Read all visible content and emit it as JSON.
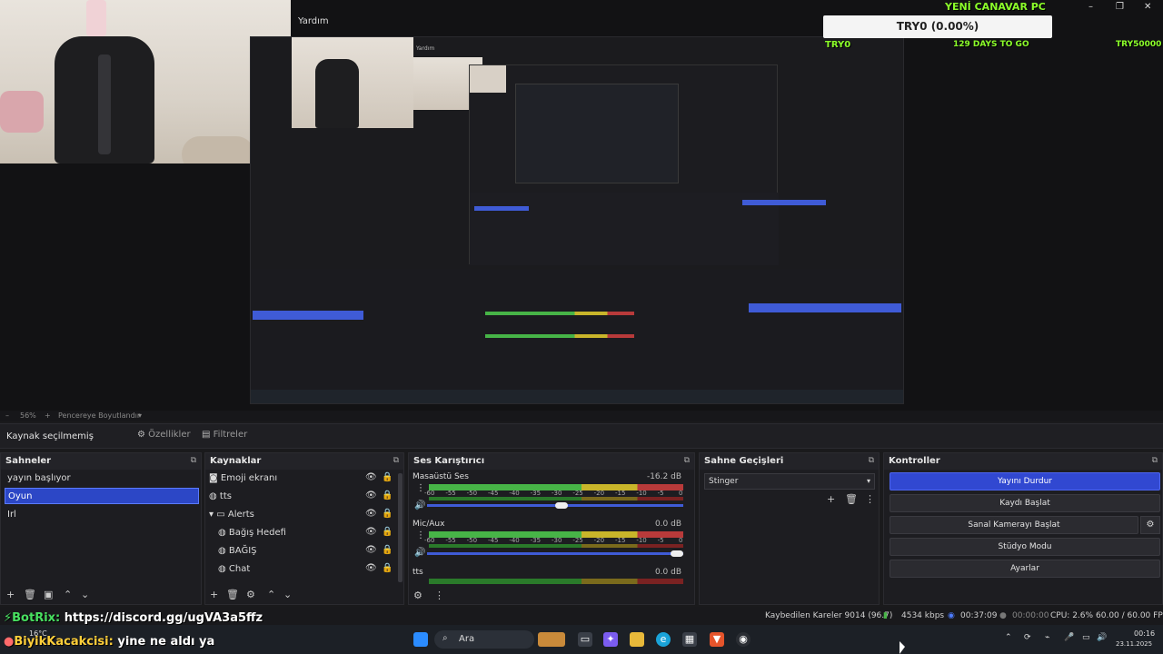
{
  "preview": {
    "window_title": "Yardım",
    "overlay": {
      "header": "YENİ CANAVAR PC",
      "progress_text": "TRY0 (0.00%)",
      "left_label": "TRY0",
      "countdown": "129 DAYS TO GO",
      "goal": "TRY50000",
      "progress_fraction": 0.0
    },
    "nested_title": "Yardım",
    "window_controls": {
      "minimize": "–",
      "maximize": "❐",
      "close": "✕"
    }
  },
  "zoombar": {
    "minus": "–",
    "zoom": "56%",
    "plus": "+",
    "fit": "Pencereye Boyutlandır",
    "dropdown": "▾"
  },
  "source_bar": {
    "label": "Kaynak seçilmemiş",
    "properties": "Özellikler",
    "filters": "Filtreler"
  },
  "scenes": {
    "title": "Sahneler",
    "items": [
      "yayın başlıyor",
      "Oyun",
      "Irl"
    ],
    "selected_index": 1
  },
  "sources": {
    "title": "Kaynaklar",
    "items": [
      {
        "label": "Emoji ekranı",
        "icon": "window-capture-icon"
      },
      {
        "label": "tts",
        "icon": "globe-icon"
      },
      {
        "label": "Alerts",
        "icon": "folder-icon"
      },
      {
        "label": "Bağış Hedefi",
        "icon": "globe-icon"
      },
      {
        "label": "BAĞIŞ",
        "icon": "globe-icon"
      },
      {
        "label": "Chat",
        "icon": "globe-icon"
      }
    ]
  },
  "mixer": {
    "title": "Ses Karıştırıcı",
    "ticks": [
      "-60",
      "-55",
      "-50",
      "-45",
      "-40",
      "-35",
      "-30",
      "-25",
      "-20",
      "-15",
      "-10",
      "-5",
      "0"
    ],
    "channels": [
      {
        "name": "Masaüstü Ses",
        "db": "-16.2 dB",
        "volume": 0.55
      },
      {
        "name": "Mic/Aux",
        "db": "0.0 dB",
        "volume": 1.0
      },
      {
        "name": "tts",
        "db": "0.0 dB",
        "volume": 1.0
      }
    ]
  },
  "transitions": {
    "title": "Sahne Geçişleri",
    "selected": "Stinger"
  },
  "controls": {
    "title": "Kontroller",
    "buttons": [
      "Yayını Durdur",
      "Kaydı Başlat",
      "Sanal Kamerayı Başlat",
      "Stüdyo Modu",
      "Ayarlar"
    ]
  },
  "status": {
    "dropped": "Kaybedilen Kareler 9014 (96.7)",
    "bitrate": "4534 kbps",
    "stream_time": "00:37:09",
    "rec_time": "00:00:00",
    "cpu": "CPU: 2.6%",
    "fps": "60.00 / 60.00 FPS"
  },
  "chat": [
    {
      "user": "BotRix:",
      "message": "https://discord.gg/ugVA3a5ffz"
    },
    {
      "user": "BiyikKacakcisi:",
      "message": "yine ne aldı ya"
    }
  ],
  "taskbar": {
    "weather": "16°C",
    "search": "Ara",
    "time": "00:16",
    "date": "23.11.2025"
  },
  "colors": {
    "accent_blue": "#3148d1",
    "overlay_green": "#8cff2a",
    "meter_green": "#47b447",
    "meter_yellow": "#c9b52a",
    "meter_red": "#b83a3a"
  }
}
